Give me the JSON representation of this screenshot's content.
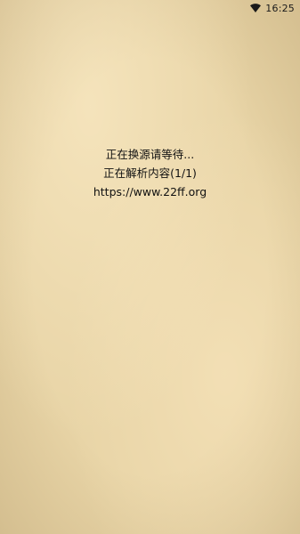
{
  "status_bar": {
    "time": "16:25",
    "icons": [
      "wifi-icon"
    ]
  },
  "loading": {
    "line1": "正在换源请等待...",
    "line2": "正在解析内容(1/1)",
    "line3": "https://www.22ff.org"
  },
  "colors": {
    "background": "#e8d4a6",
    "text": "#111111"
  }
}
